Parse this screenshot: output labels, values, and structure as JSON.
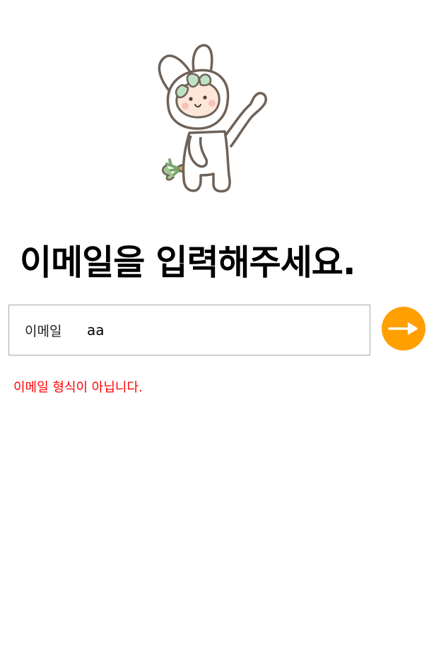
{
  "illustration": {
    "icon": "bunny-with-carrot-waving-icon"
  },
  "page": {
    "title": "이메일을 입력해주세요."
  },
  "form": {
    "email_label": "이메일",
    "email_value": "aa",
    "next_button_icon": "arrow-right-icon",
    "error_message": "이메일 형식이 아닙니다."
  },
  "colors": {
    "accent": "#ff9f00",
    "error": "#ff0000",
    "input_border": "#a9a9a9",
    "title": "#000000"
  }
}
